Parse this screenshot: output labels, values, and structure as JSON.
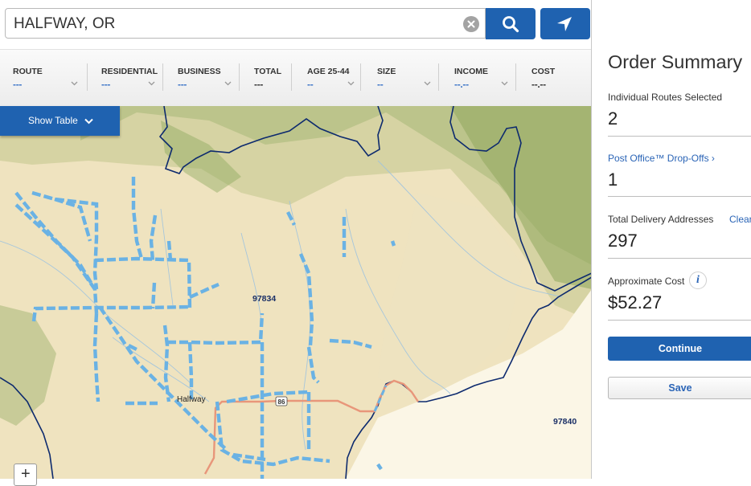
{
  "search": {
    "value": "HALFWAY, OR"
  },
  "filters": {
    "columns": [
      {
        "header": "ROUTE",
        "value": "---",
        "dropdown": true
      },
      {
        "header": "RESIDENTIAL",
        "value": "---",
        "dropdown": true
      },
      {
        "header": "BUSINESS",
        "value": "---",
        "dropdown": true
      },
      {
        "header": "TOTAL",
        "value": "---",
        "dropdown": false
      },
      {
        "header": "AGE 25-44",
        "value": "--",
        "dropdown": true
      },
      {
        "header": "SIZE",
        "value": "--",
        "dropdown": true
      },
      {
        "header": "INCOME",
        "value": "--.--",
        "dropdown": true
      },
      {
        "header": "COST",
        "value": "--.--",
        "dropdown": false
      }
    ]
  },
  "map": {
    "show_table_label": "Show Table",
    "zoom_in_label": "+",
    "labels": {
      "town": "Halfway",
      "zip_1": "97834",
      "zip_2": "97840",
      "highway": "86"
    }
  },
  "summary": {
    "title": "Order Summary",
    "routes_label": "Individual Routes Selected",
    "routes_value": "2",
    "dropoffs_link": "Post Office™ Drop-Offs ›",
    "dropoffs_value": "1",
    "addresses_label": "Total Delivery Addresses",
    "clear_link": "Clear",
    "addresses_value": "297",
    "cost_label": "Approximate Cost",
    "cost_value": "$52.27",
    "continue_label": "Continue",
    "save_label": "Save"
  },
  "colors": {
    "primary_blue": "#1f62b0",
    "route_blue": "#6ab2e4",
    "boundary_navy": "#0d2a6e",
    "highway_orange": "#e8967a",
    "map_tan": "#efe3bf",
    "forest_green": "#b9c68a"
  },
  "icons": {
    "clear": "clear-icon",
    "search": "search-icon",
    "locate": "location-arrow-icon",
    "chevron": "chevron-down-icon",
    "info": "info-icon"
  }
}
